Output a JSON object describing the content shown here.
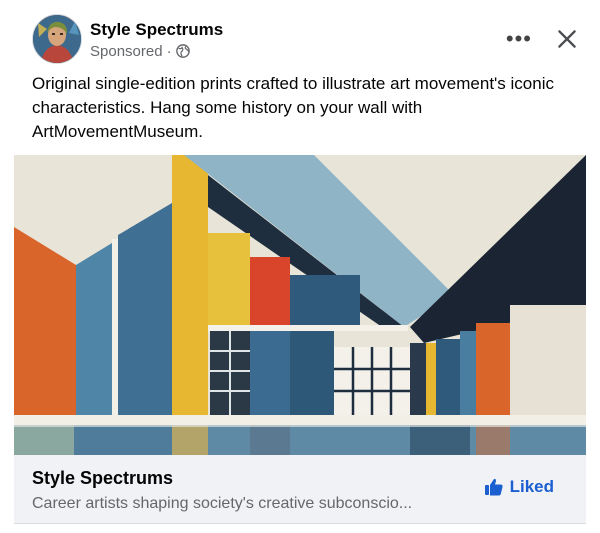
{
  "post": {
    "page_name": "Style Spectrums",
    "sponsored_label": "Sponsored",
    "dot_separator": "·",
    "more_label": "•••",
    "caption": "Original single-edition prints crafted to illustrate art movement's iconic characteristics. Hang some history on your wall with ArtMovementMuseum."
  },
  "cta": {
    "title": "Style Spectrums",
    "description": "Career artists shaping society's creative subconscio...",
    "like_label": "Liked"
  },
  "icons": {
    "avatar": "avatar-image",
    "globe": "globe-icon",
    "more": "more-options-icon",
    "close": "close-icon",
    "like": "thumbs-up-icon"
  },
  "colors": {
    "link_blue": "#1b5fd1",
    "secondary_text": "#65676b",
    "cta_background": "#f0f2f5"
  }
}
